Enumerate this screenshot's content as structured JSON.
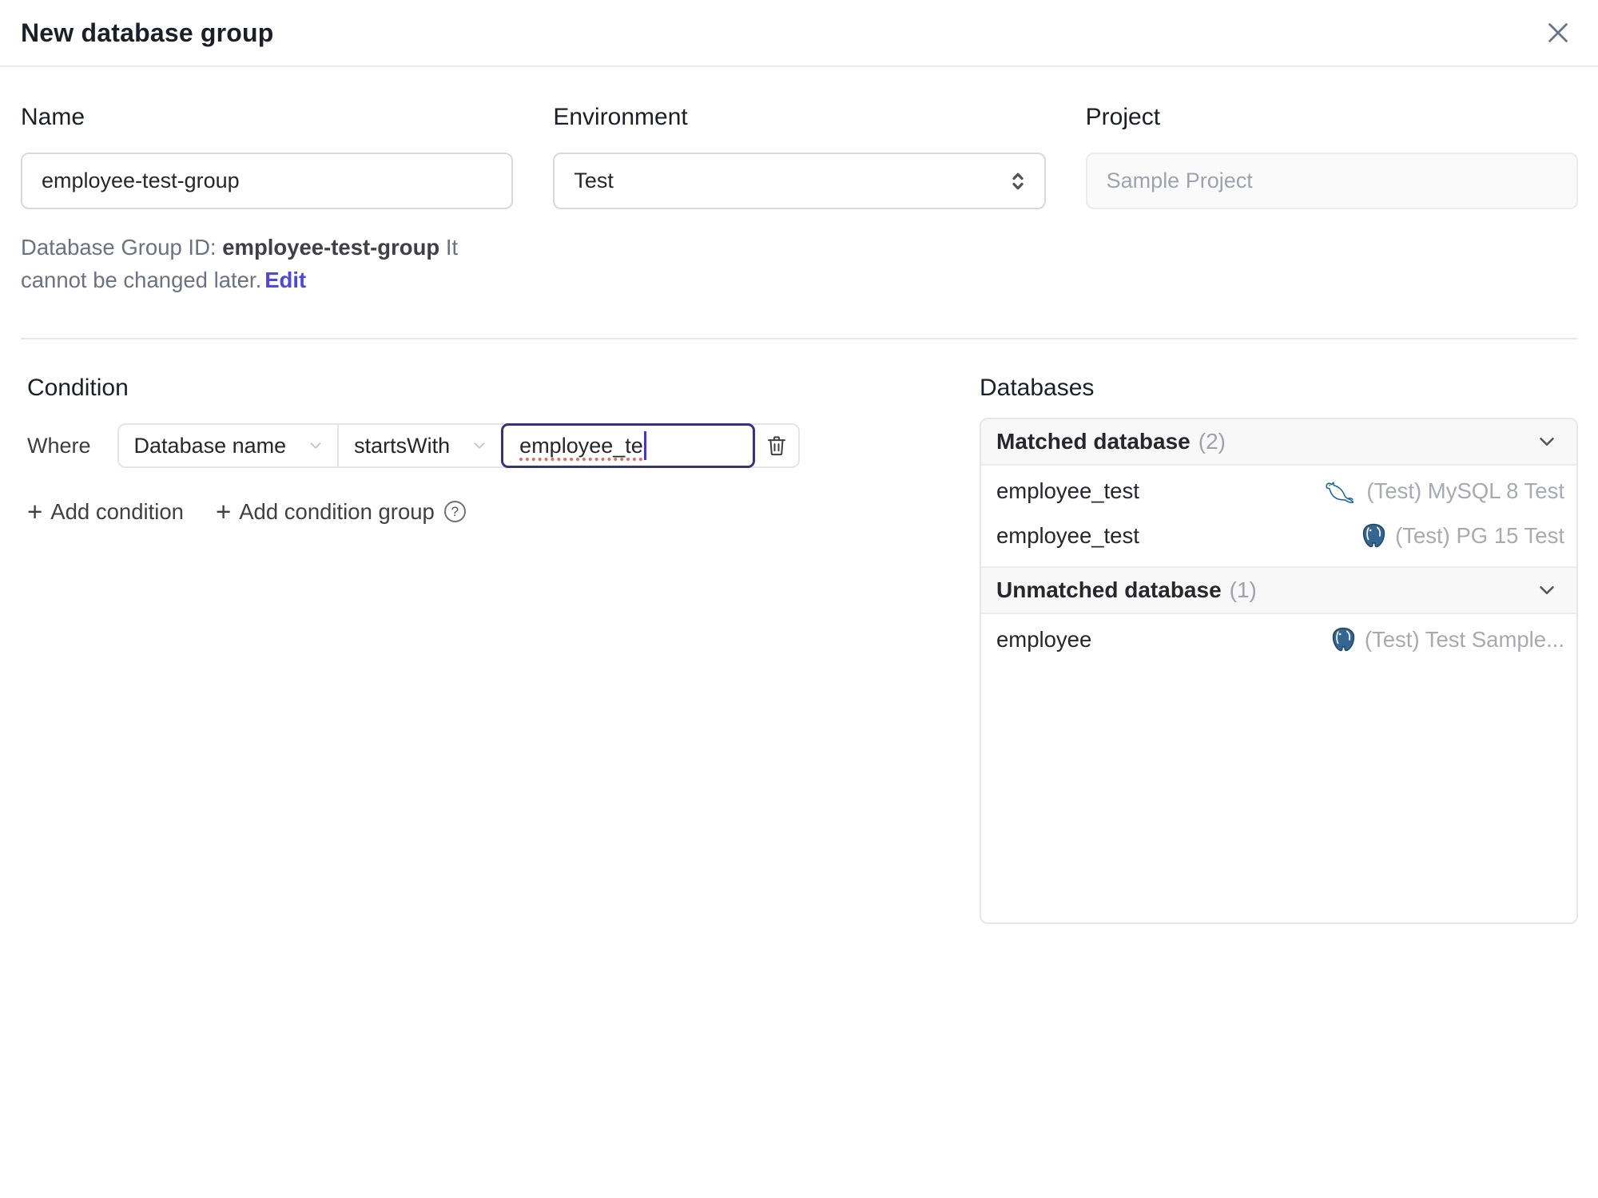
{
  "dialog": {
    "title": "New database group"
  },
  "form": {
    "name": {
      "label": "Name",
      "value": "employee-test-group"
    },
    "environment": {
      "label": "Environment",
      "value": "Test"
    },
    "project": {
      "label": "Project",
      "value": "Sample Project"
    },
    "group_id_note": {
      "prefix": "Database Group ID: ",
      "id": "employee-test-group",
      "suffix": " It cannot be changed later.",
      "edit_label": "Edit"
    }
  },
  "condition": {
    "heading": "Condition",
    "where_label": "Where",
    "factor": "Database name",
    "operator": "startsWith",
    "value": "employee_te",
    "add_condition_label": "Add condition",
    "add_condition_group_label": "Add condition group",
    "help_glyph": "?",
    "plus_glyph": "+"
  },
  "databases": {
    "heading": "Databases",
    "matched": {
      "title": "Matched database",
      "count": "(2)",
      "rows": [
        {
          "name": "employee_test",
          "engine": "mysql",
          "instance": "(Test) MySQL 8 Test"
        },
        {
          "name": "employee_test",
          "engine": "postgresql",
          "instance": "(Test) PG 15 Test"
        }
      ]
    },
    "unmatched": {
      "title": "Unmatched database",
      "count": "(1)",
      "rows": [
        {
          "name": "employee",
          "engine": "postgresql",
          "instance": "(Test) Test Sample..."
        }
      ]
    }
  },
  "colors": {
    "accent": "#4f46e5",
    "focus_border": "#37327f",
    "spellcheck_underline": "#e06c6c",
    "mysql_icon": "#1e6a96",
    "postgresql_icon": "#336791",
    "muted_text": "#a7aab0",
    "border": "#e4e4e7"
  }
}
